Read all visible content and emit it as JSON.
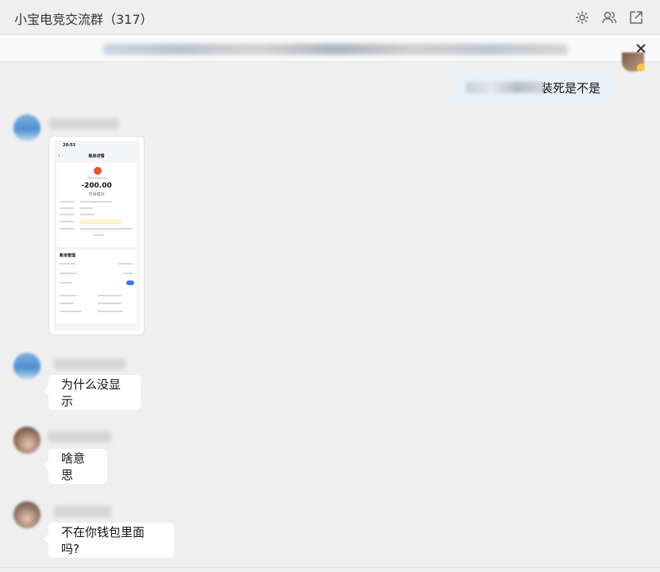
{
  "window": {
    "title": "小宝电竞交流群（317）"
  },
  "toolbar": {
    "icons": [
      "gear-icon",
      "members-icon",
      "popout-icon"
    ]
  },
  "notice": {
    "close_icon": "close-icon"
  },
  "messages": [
    {
      "side": "me",
      "text": "装死是不是"
    },
    {
      "side": "other",
      "type": "image",
      "image": {
        "time": "20:53",
        "header": "账单详情",
        "amount": "-200.00",
        "amount_sub": "交易成功",
        "section": "账单管理"
      }
    },
    {
      "side": "other",
      "text": "为什么没显示"
    },
    {
      "side": "other",
      "text": "啥意思"
    },
    {
      "side": "other",
      "text": "不在你钱包里面吗?"
    }
  ],
  "colors": {
    "accent": "#3b7ddd",
    "bubble_me": "#e8f0f8",
    "bubble_other": "#ffffff",
    "background": "#efefef"
  }
}
